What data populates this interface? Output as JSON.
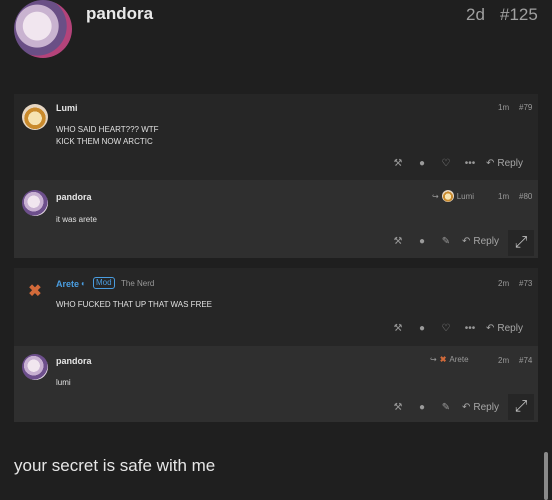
{
  "header": {
    "username": "pandora",
    "age": "2d",
    "post_number": "#125"
  },
  "quotes": [
    {
      "username": "Lumi",
      "age": "1m",
      "post_number": "#79",
      "body_lines": [
        "WHO SAID HEART??? WTF",
        "KICK THEM NOW ARCTIC"
      ],
      "reply_label": "Reply"
    },
    {
      "username": "pandora",
      "age": "1m",
      "post_number": "#80",
      "reply_to": "Lumi",
      "body_lines": [
        "it was arete"
      ],
      "reply_label": "Reply"
    },
    {
      "username": "Arete",
      "badge": "Mod",
      "user_title": "The Nerd",
      "age": "2m",
      "post_number": "#73",
      "body_lines": [
        "WHO FUCKED THAT UP THAT WAS FREE"
      ],
      "reply_label": "Reply"
    },
    {
      "username": "pandora",
      "age": "2m",
      "post_number": "#74",
      "reply_to": "Arete",
      "body_lines": [
        "lumi"
      ],
      "reply_label": "Reply"
    }
  ],
  "footer_text": "your secret is safe with me",
  "icons": {
    "flag": "gavel-icon",
    "user": "user-card-icon",
    "like": "heart-icon",
    "more": "ellipsis-icon",
    "edit": "pencil-icon",
    "reply": "reply-arrow-icon",
    "expand": "expand-icon"
  },
  "colors": {
    "background": "#1f1f1f",
    "panel_dark": "#262626",
    "panel_light": "#2f2f2f",
    "mod_blue": "#4a9de0"
  }
}
